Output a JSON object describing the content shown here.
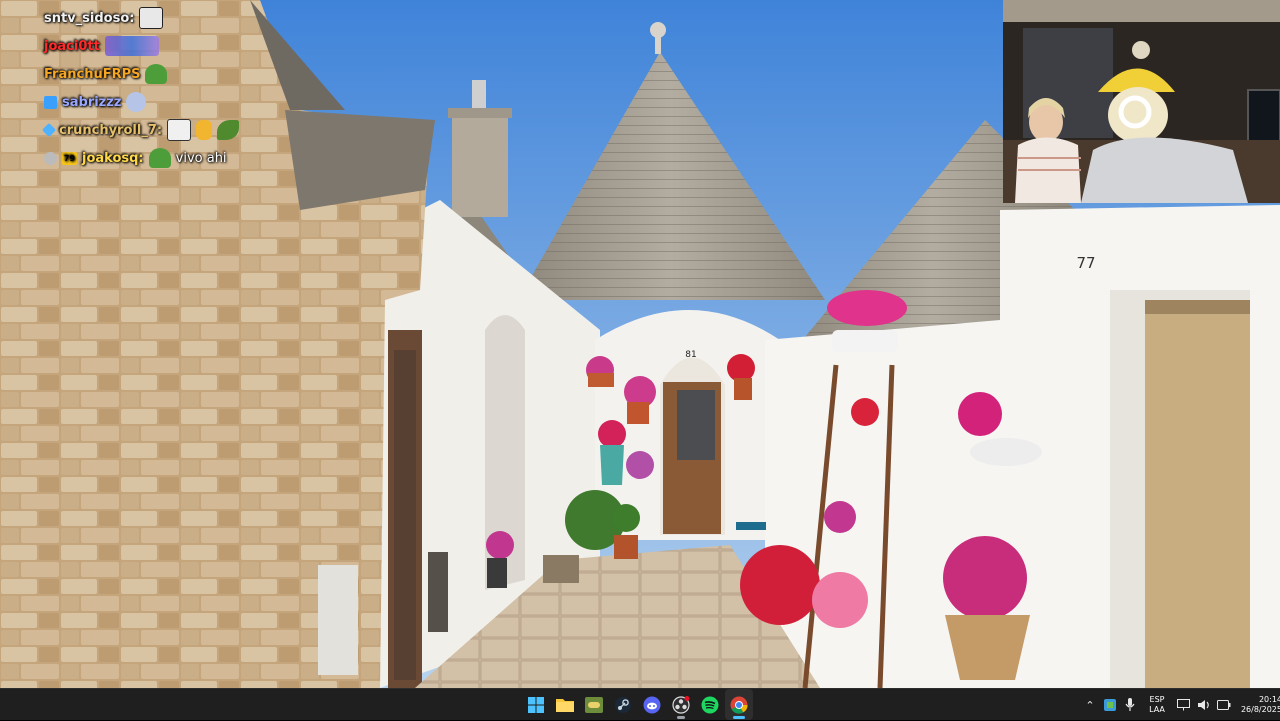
{
  "chat": {
    "messages": [
      {
        "user": "sntv_sidoso:",
        "user_color": "#f2f2f2",
        "text": "",
        "emotes": [
          "face-emote"
        ],
        "badges": []
      },
      {
        "user": "joaci0tt",
        "user_color": "#ff2a2a",
        "text": "",
        "emotes": [
          "blurred-emote"
        ],
        "badges": []
      },
      {
        "user": "FranchuFRPS",
        "user_color": "#f5a623",
        "text": "",
        "emotes": [
          "pepe-emote"
        ],
        "badges": []
      },
      {
        "user": "sabrizzz",
        "user_color": "#9aa7ff",
        "text": "",
        "emotes": [
          "ghost-emote"
        ],
        "badges": [
          "cube-badge"
        ]
      },
      {
        "user": "crunchyroll_7:",
        "user_color": "#e6c06b",
        "text": "",
        "emotes": [
          "meme-face-emote",
          "point-hand-emote",
          "leaf-emote"
        ],
        "badges": [
          "sword-badge"
        ]
      },
      {
        "user": "joakosq:",
        "user_color": "#ffd94a",
        "text": "vivo ahi",
        "emotes": [
          "pepe-glasses-emote"
        ],
        "badges": [
          "skull-badge",
          "sub-badge"
        ],
        "sub_badge_text": "79"
      }
    ]
  },
  "scene": {
    "door_number_left": "81",
    "house_number_right": "77"
  },
  "taskbar": {
    "pinned": [
      {
        "name": "start-button",
        "icon": "windows-logo-icon"
      },
      {
        "name": "file-explorer-button",
        "icon": "folder-icon"
      },
      {
        "name": "game-app-button",
        "icon": "gamepad-icon"
      },
      {
        "name": "steam-button",
        "icon": "steam-icon"
      },
      {
        "name": "discord-button",
        "icon": "discord-icon"
      },
      {
        "name": "obs-button",
        "icon": "obs-icon"
      },
      {
        "name": "spotify-button",
        "icon": "spotify-icon"
      },
      {
        "name": "chrome-button",
        "icon": "chrome-icon"
      }
    ],
    "language_line1": "ESP",
    "language_line2": "LAA",
    "time": "20:14",
    "date": "26/8/2025",
    "accent_color": "#4cc2ff"
  }
}
